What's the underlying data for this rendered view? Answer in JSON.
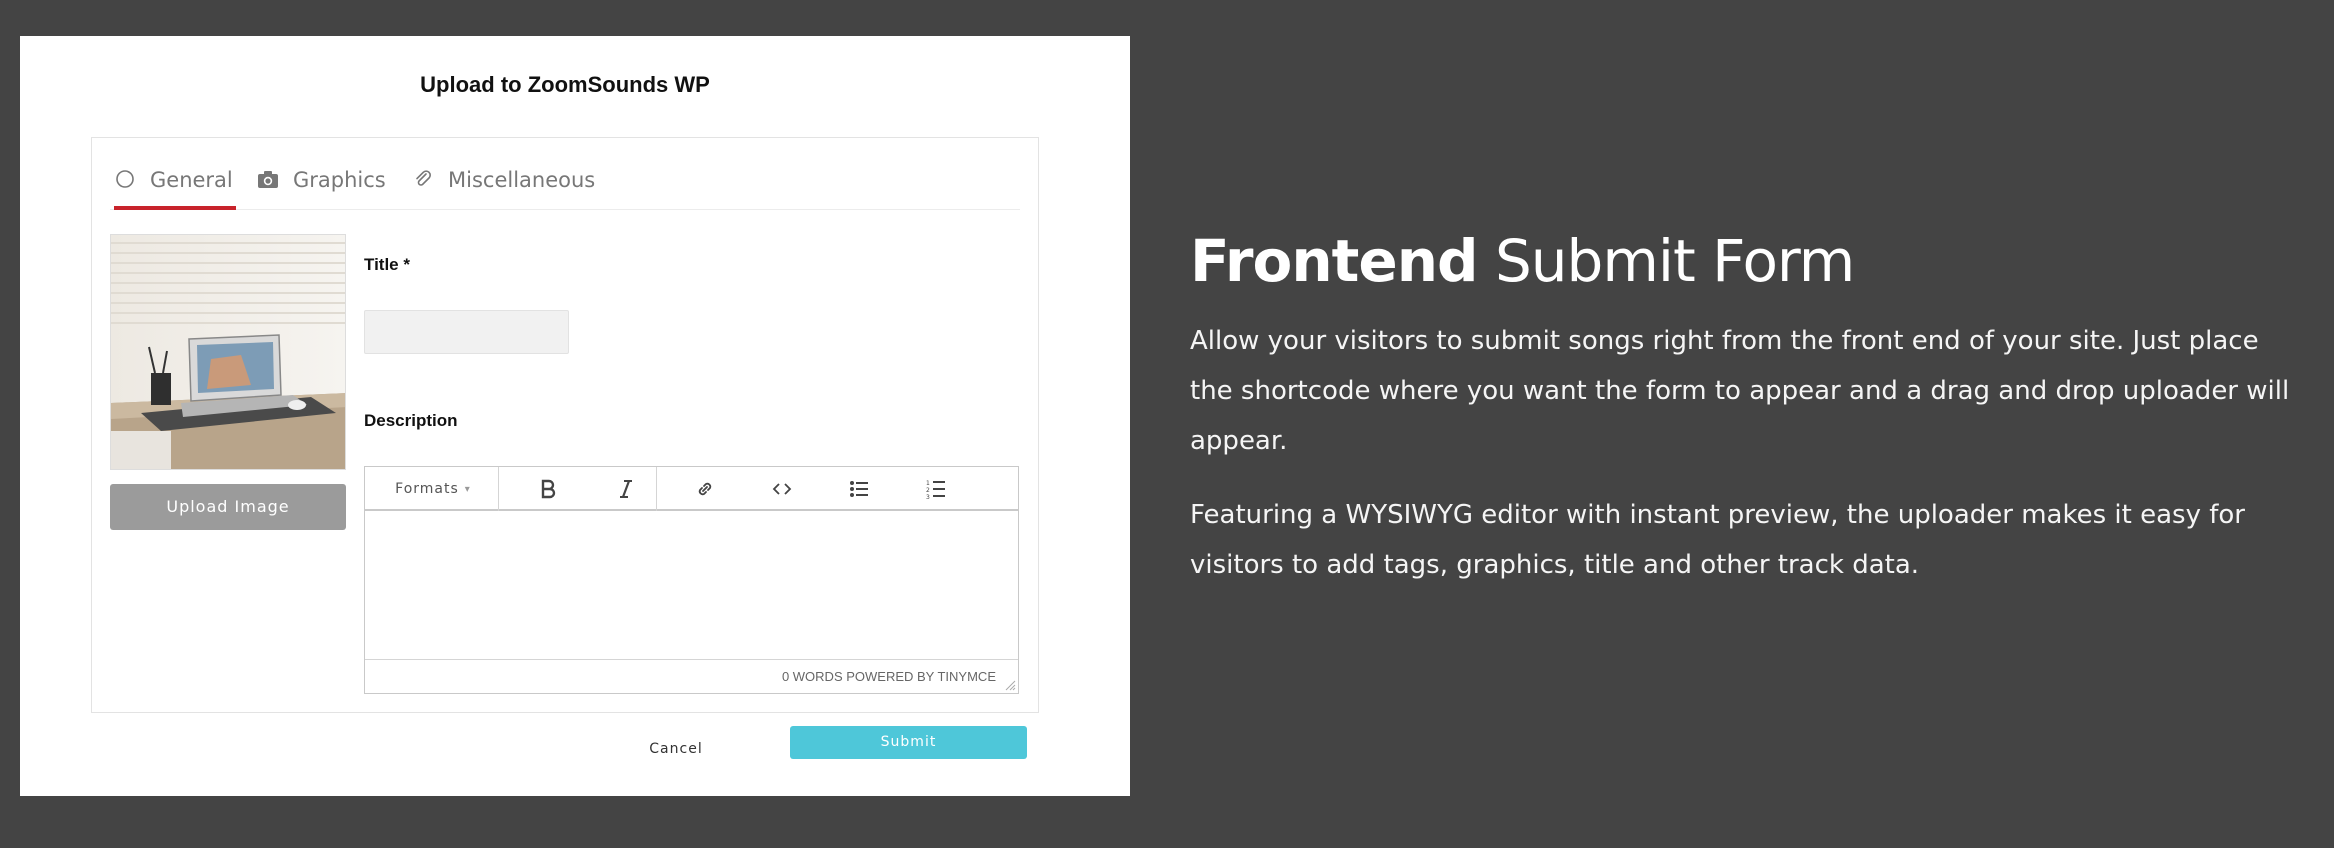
{
  "modal": {
    "title": "Upload to ZoomSounds WP",
    "tabs": [
      {
        "label": "General",
        "icon": "circle-icon",
        "active": true
      },
      {
        "label": "Graphics",
        "icon": "camera-icon",
        "active": false
      },
      {
        "label": "Miscellaneous",
        "icon": "paperclip-icon",
        "active": false
      }
    ],
    "upload_image_label": "Upload Image",
    "title_label": "Title *",
    "title_value": "",
    "description_label": "Description",
    "editor": {
      "formats_label": "Formats",
      "tools": [
        "bold-icon",
        "italic-icon",
        "link-icon",
        "code-icon",
        "bullet-list-icon",
        "numbered-list-icon"
      ],
      "status": "0 WORDS POWERED BY TINYMCE"
    },
    "cancel_label": "Cancel",
    "submit_label": "Submit"
  },
  "promo": {
    "title_bold": "Frontend",
    "title_rest": " Submit Form",
    "paragraph_1": "Allow your visitors to submit songs right from the front end of your site. Just place the shortcode where you want the form to appear and a drag and drop uploader will appear.",
    "paragraph_2": "Featuring a WYSIWYG editor with instant preview, the uploader makes it easy for visitors to add tags, graphics, title and other track data."
  },
  "colors": {
    "background": "#444444",
    "tab_active_underline": "#c8232b",
    "submit": "#4ec7d9",
    "upload_button": "#9b9b9b"
  }
}
